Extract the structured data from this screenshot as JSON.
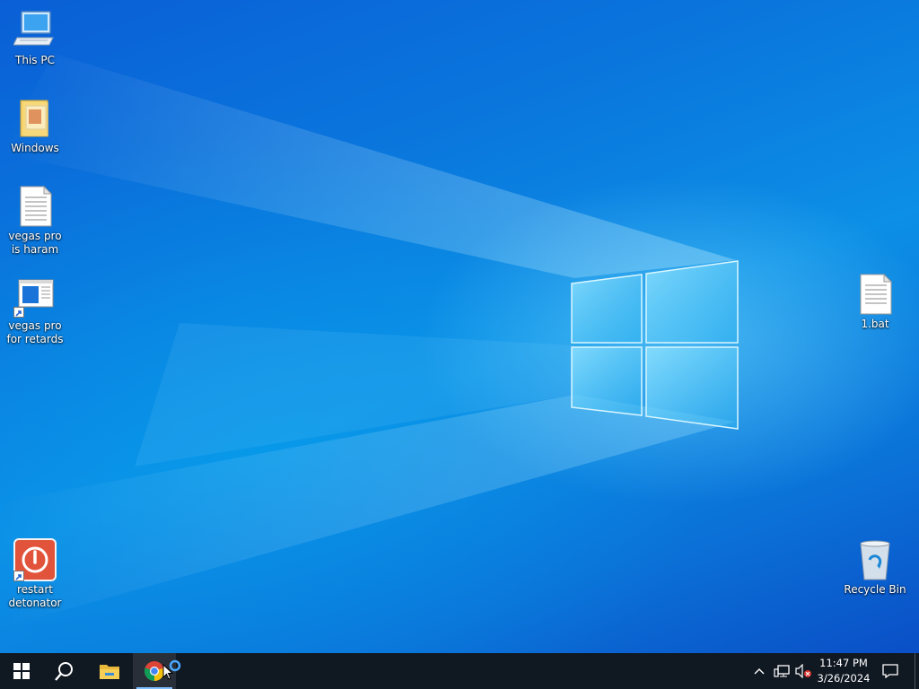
{
  "desktop": {
    "icons": [
      {
        "label": "This PC",
        "icon": "computer-icon"
      },
      {
        "label": "Windows",
        "icon": "folder-icon"
      },
      {
        "label": "vegas pro is haram",
        "icon": "text-document-icon"
      },
      {
        "label": "vegas pro for retards",
        "icon": "app-shortcut-icon"
      },
      {
        "label": "restart detonator",
        "icon": "power-icon"
      },
      {
        "label": "1.bat",
        "icon": "batch-file-icon"
      },
      {
        "label": "Recycle Bin",
        "icon": "recycle-bin-icon"
      }
    ]
  },
  "taskbar": {
    "start_icon": "windows-start-icon",
    "search_icon": "search-icon",
    "apps": [
      {
        "name": "File Explorer",
        "icon": "folder-icon"
      },
      {
        "name": "Google Chrome",
        "icon": "chrome-icon",
        "active": true
      }
    ],
    "tray": {
      "icons": [
        "chevron-up-icon",
        "network-icon",
        "volume-muted-icon"
      ],
      "time": "11:47 PM",
      "date": "3/26/2024"
    }
  },
  "colors": {
    "taskbar_bg": "#101822",
    "accent": "#0a77dd"
  }
}
